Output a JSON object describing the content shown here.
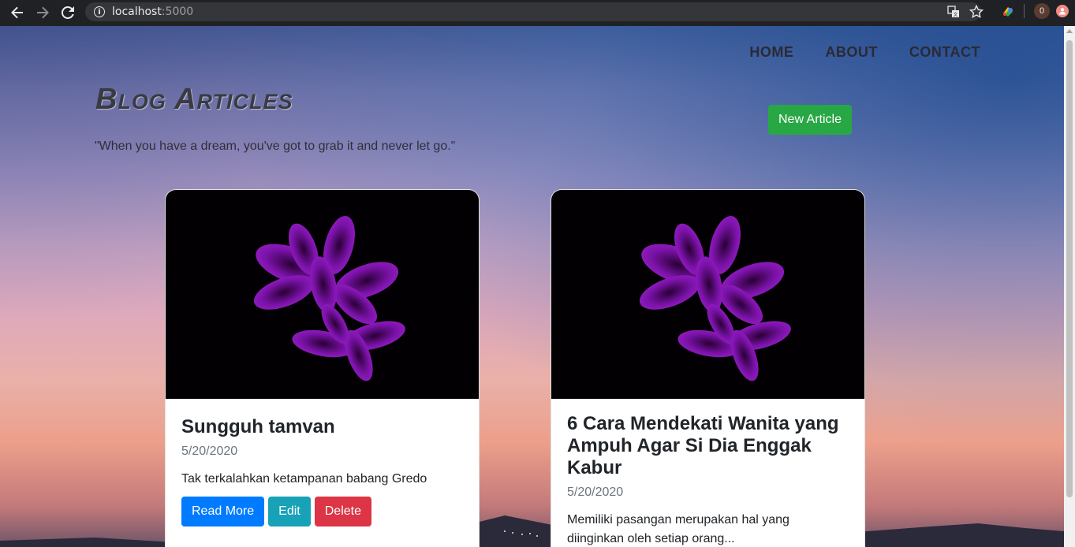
{
  "browser": {
    "url_host": "localhost",
    "url_port": ":5000",
    "extension_badge": "0"
  },
  "nav": {
    "home": "HOME",
    "about": "ABOUT",
    "contact": "CONTACT"
  },
  "header": {
    "title": "Blog Articles",
    "quote": "\"When you have a dream, you've got to grab it and never let go.\"",
    "new_article_label": "New Article"
  },
  "articles": [
    {
      "title": "Sungguh tamvan",
      "date": "5/20/2020",
      "excerpt": "Tak terkalahkan ketampanan babang Gredo",
      "read_more": "Read More",
      "edit": "Edit",
      "delete": "Delete"
    },
    {
      "title": "6 Cara Mendekati Wanita yang Ampuh Agar Si Dia Enggak Kabur",
      "date": "5/20/2020",
      "excerpt": "Memiliki pasangan merupakan hal yang diinginkan oleh setiap orang..."
    }
  ],
  "colors": {
    "success": "#28a745",
    "primary": "#007bff",
    "info": "#17a2b8",
    "danger": "#dc3545"
  }
}
